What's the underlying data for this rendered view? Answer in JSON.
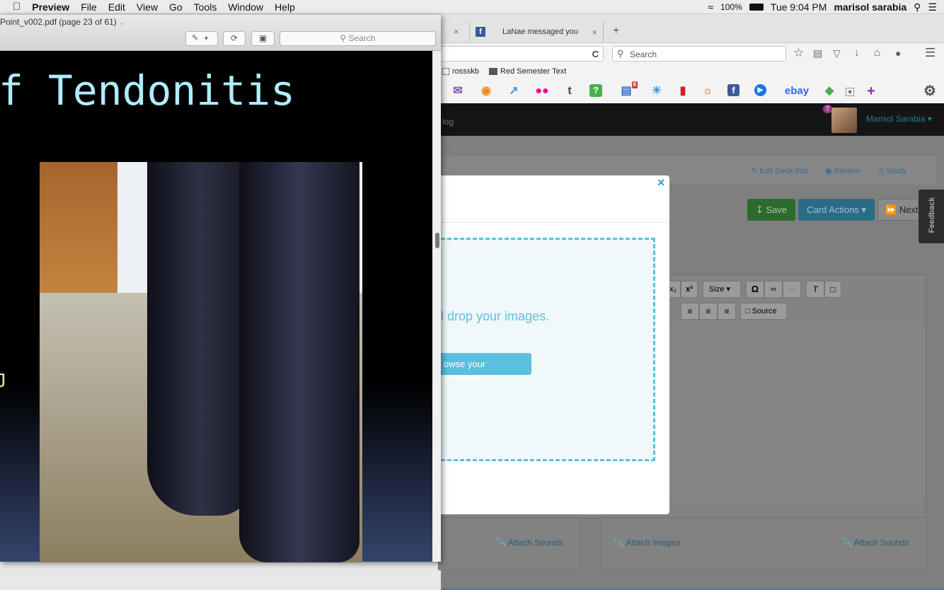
{
  "menubar": {
    "apple_icon": "apple-icon",
    "items": [
      "Preview",
      "File",
      "Edit",
      "View",
      "Go",
      "Tools",
      "Window",
      "Help"
    ],
    "battery": "100%",
    "clock": "Tue 9:04 PM",
    "user": "marisol sarabia"
  },
  "preview": {
    "title": "Point_v002.pdf (page 23 of 61)",
    "search_placeholder": "Search",
    "slide_title": "f Tendonitis",
    "slide_marker": "J"
  },
  "browser": {
    "tab1_close": "×",
    "tab2_label": "LaNae messaged you",
    "tab2_close": "×",
    "new_tab": "+",
    "search_placeholder": "Search",
    "reload": "C"
  },
  "bookmarks": [
    "rossskb",
    "Red Semester Text"
  ],
  "bookmark_icons": {
    "notification_count": "8",
    "ebay": "ebay"
  },
  "site": {
    "nav_partial": "log",
    "notif_count": "7",
    "username": "Marisol Sarabia ▾",
    "edit_deck_info": "Edit Deck Info",
    "review": "Review",
    "study": "Study",
    "save": "Save",
    "card_actions": "Card Actions ▾",
    "next": "Next",
    "feedback": "Feedback"
  },
  "editor": {
    "size_label": "Size",
    "source_label": "Source"
  },
  "attach": {
    "sounds_left": "Attach Sounds",
    "images": "Attach Images",
    "sounds_right": "Attach Sounds"
  },
  "modal": {
    "close": "×",
    "drop_text": "l drop your images.",
    "browse_button": "owse your computer"
  },
  "colors": {
    "accent": "#5bc0de",
    "save_green": "#3f9e3f",
    "card_actions_blue": "#4aa3c6",
    "slide_title": "#aeeefb"
  }
}
